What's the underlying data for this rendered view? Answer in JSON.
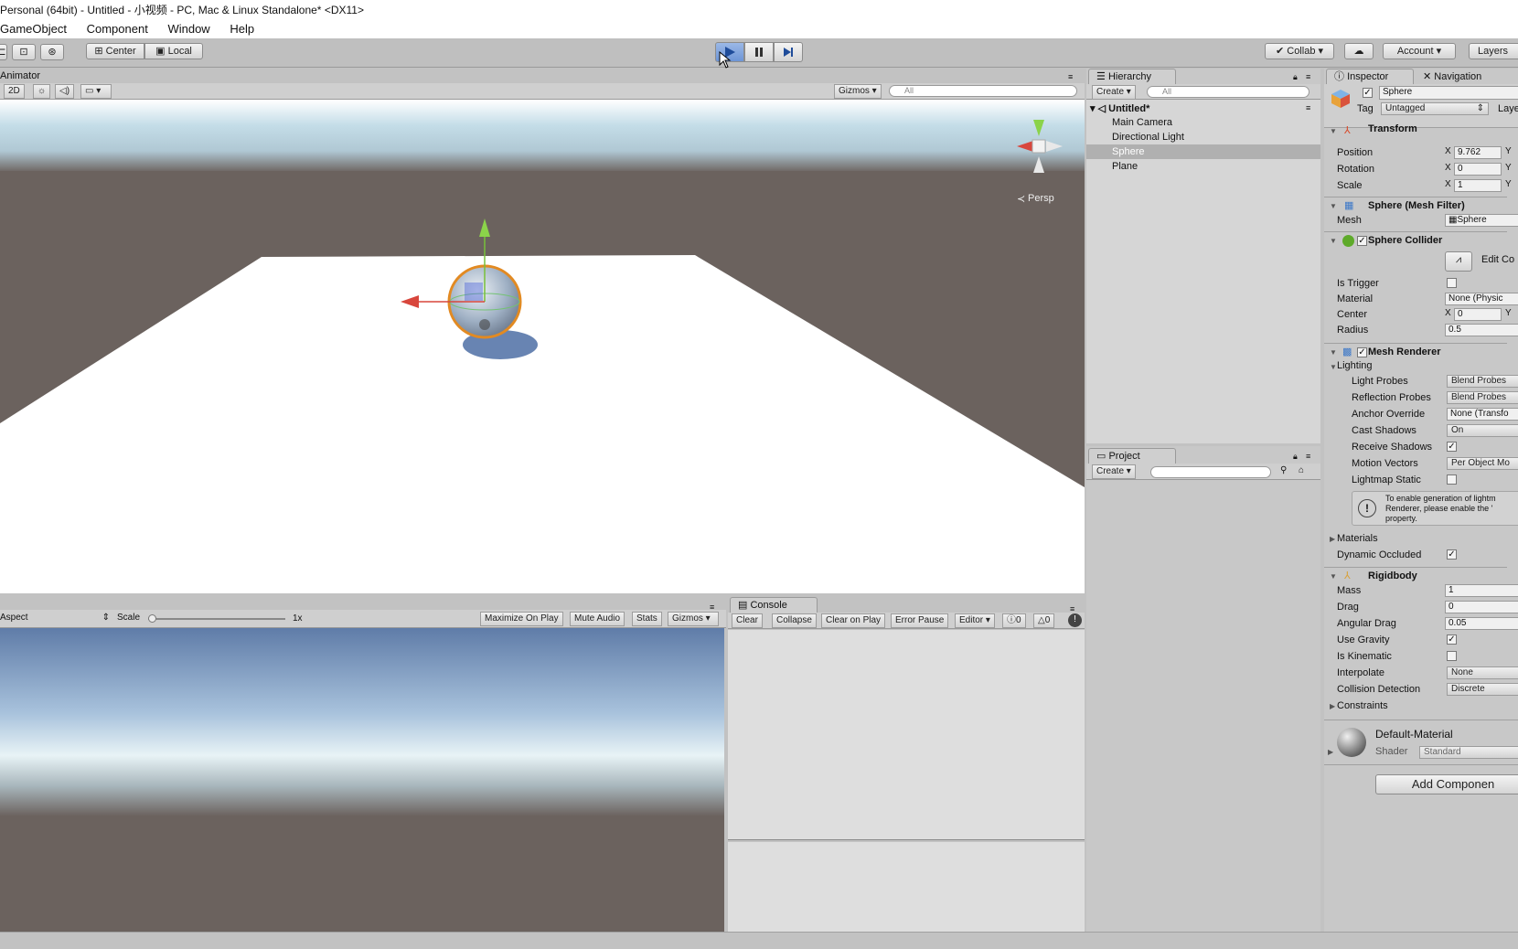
{
  "window": {
    "title": "Personal (64bit) - Untitled - 小视频 - PC, Mac & Linux Standalone* <DX11>"
  },
  "menu": [
    "GameObject",
    "Component",
    "Window",
    "Help"
  ],
  "toolbar": {
    "center": "Center",
    "local": "Local",
    "collab": "Collab ▾",
    "account": "Account",
    "layers": "Layers"
  },
  "scene": {
    "tab": "Animator",
    "mode_2d": "2D",
    "gizmos": "Gizmos",
    "search_placeholder": "All",
    "persp": "Persp"
  },
  "game": {
    "aspect": "Aspect",
    "scale_label": "Scale",
    "scale_value": "1x",
    "buttons": [
      "Maximize On Play",
      "Mute Audio",
      "Stats",
      "Gizmos"
    ]
  },
  "console": {
    "tab": "Console",
    "buttons": [
      "Clear",
      "Collapse",
      "Clear on Play",
      "Error Pause",
      "Editor"
    ],
    "info_count": "0",
    "warn_count": "0"
  },
  "hierarchy": {
    "tab": "Hierarchy",
    "create": "Create",
    "search_placeholder": "All",
    "scene_name": "Untitled*",
    "items": [
      "Main Camera",
      "Directional Light",
      "Sphere",
      "Plane"
    ],
    "selected": "Sphere"
  },
  "project": {
    "tab": "Project",
    "create": "Create"
  },
  "inspector": {
    "tab": "Inspector",
    "tab2": "Navigation",
    "object_name": "Sphere",
    "tag_label": "Tag",
    "tag_value": "Untagged",
    "layer_label": "Laye",
    "transform": {
      "title": "Transform",
      "position_label": "Position",
      "position_x": "9.762",
      "rotation_label": "Rotation",
      "rotation_x": "0",
      "scale_label": "Scale",
      "scale_x": "1",
      "x_letter": "X",
      "y_letter": "Y"
    },
    "mesh_filter": {
      "title": "Sphere (Mesh Filter)",
      "mesh_label": "Mesh",
      "mesh_value": "Sphere"
    },
    "sphere_collider": {
      "title": "Sphere Collider",
      "edit": "Edit Co",
      "is_trigger": "Is Trigger",
      "material": "Material",
      "material_value": "None (Physic",
      "center": "Center",
      "center_x": "0",
      "radius": "Radius",
      "radius_value": "0.5"
    },
    "mesh_renderer": {
      "title": "Mesh Renderer",
      "lighting": "Lighting",
      "light_probes": "Light Probes",
      "light_probes_value": "Blend Probes",
      "reflection_probes": "Reflection Probes",
      "reflection_probes_value": "Blend Probes",
      "anchor_override": "Anchor Override",
      "anchor_override_value": "None (Transfo",
      "cast_shadows": "Cast Shadows",
      "cast_shadows_value": "On",
      "receive_shadows": "Receive Shadows",
      "motion_vectors": "Motion Vectors",
      "motion_vectors_value": "Per Object Mo",
      "lightmap_static": "Lightmap Static",
      "info": "To enable generation of lightm Renderer, please enable the ' property.",
      "materials": "Materials",
      "dynamic_occluded": "Dynamic Occluded"
    },
    "rigidbody": {
      "title": "Rigidbody",
      "mass": "Mass",
      "mass_value": "1",
      "drag": "Drag",
      "drag_value": "0",
      "angular_drag": "Angular Drag",
      "angular_drag_value": "0.05",
      "use_gravity": "Use Gravity",
      "is_kinematic": "Is Kinematic",
      "interpolate": "Interpolate",
      "interpolate_value": "None",
      "collision_detection": "Collision Detection",
      "collision_detection_value": "Discrete",
      "constraints": "Constraints"
    },
    "material": {
      "name": "Default-Material",
      "shader_label": "Shader",
      "shader_value": "Standard"
    },
    "add_component": "Add Componen"
  },
  "colors": {
    "accent": "#3c78c8",
    "selection": "#b0b0b0",
    "ground": "#6b625e",
    "plane": "#ffffff"
  }
}
